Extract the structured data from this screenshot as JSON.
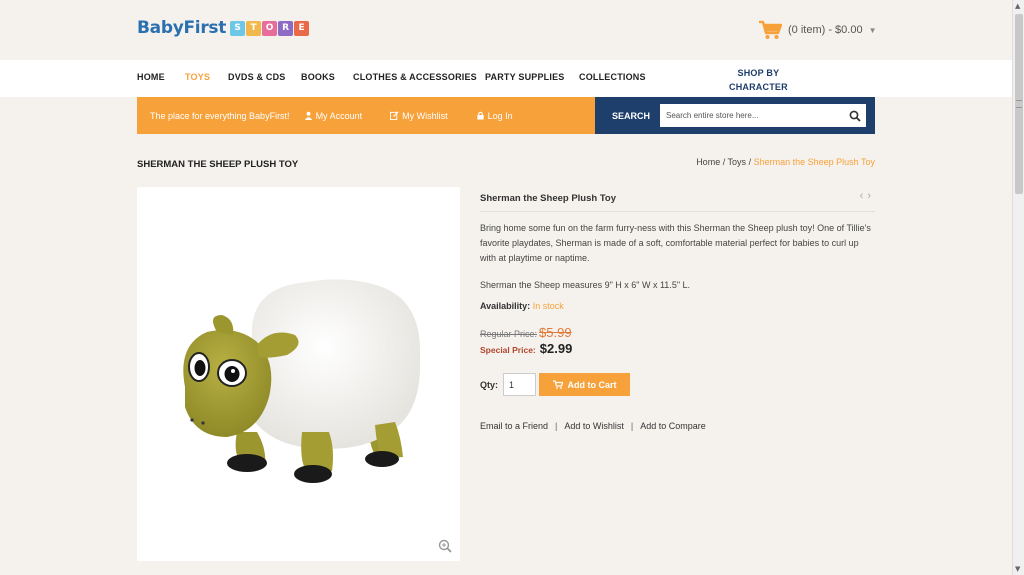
{
  "logo": {
    "text": "BabyFirst",
    "blocks": [
      {
        "letter": "S",
        "color": "#6fc7e8"
      },
      {
        "letter": "T",
        "color": "#f2b84b"
      },
      {
        "letter": "O",
        "color": "#e86d9a"
      },
      {
        "letter": "R",
        "color": "#8d6bc4"
      },
      {
        "letter": "E",
        "color": "#e86a4a"
      }
    ]
  },
  "cart": {
    "summary": "(0 item) - $0.00",
    "icon": "shopping-cart-icon"
  },
  "nav": {
    "home": "HOME",
    "toys": "TOYS",
    "dvds": "DVDS & CDS",
    "books": "BOOKS",
    "clothes": "CLOTHES & ACCESSORIES",
    "party": "PARTY SUPPLIES",
    "collections": "COLLECTIONS",
    "character_line1": "SHOP BY",
    "character_line2": "CHARACTER"
  },
  "promo": {
    "tagline": "The place for everything BabyFirst!",
    "account": "My Account",
    "wishlist": "My Wishlist",
    "login": "Log In"
  },
  "search": {
    "label": "SEARCH",
    "placeholder": "Search entire store here..."
  },
  "page": {
    "title": "SHERMAN THE SHEEP PLUSH TOY",
    "breadcrumb": {
      "home": "Home",
      "sep": " / ",
      "toys": "Toys",
      "current": "Sherman the Sheep Plush Toy"
    }
  },
  "product": {
    "name": "Sherman the Sheep Plush Toy",
    "description": "Bring home some fun on the farm furry-ness with this Sherman the Sheep plush toy! One of Tillie's favorite playdates, Sherman is made of a soft, comfortable material perfect for babies to curl up with at playtime or naptime.",
    "measurements": "Sherman the Sheep measures 9\" H x 6\" W x 11.5\" L.",
    "availability_label": "Availability:",
    "availability_value": "In stock",
    "regular_price_label": "Regular Price:",
    "regular_price": "$5.99",
    "special_price_label": "Special Price:",
    "special_price": "$2.99",
    "qty_label": "Qty:",
    "qty_value": "1",
    "add_to_cart": "Add to Cart",
    "links": {
      "email": "Email to a Friend",
      "wishlist": "Add to Wishlist",
      "compare": "Add to Compare",
      "sep": "|"
    }
  },
  "colors": {
    "accent": "#f7a13b",
    "navy": "#1e3f6b",
    "background": "#f5f2ed"
  }
}
